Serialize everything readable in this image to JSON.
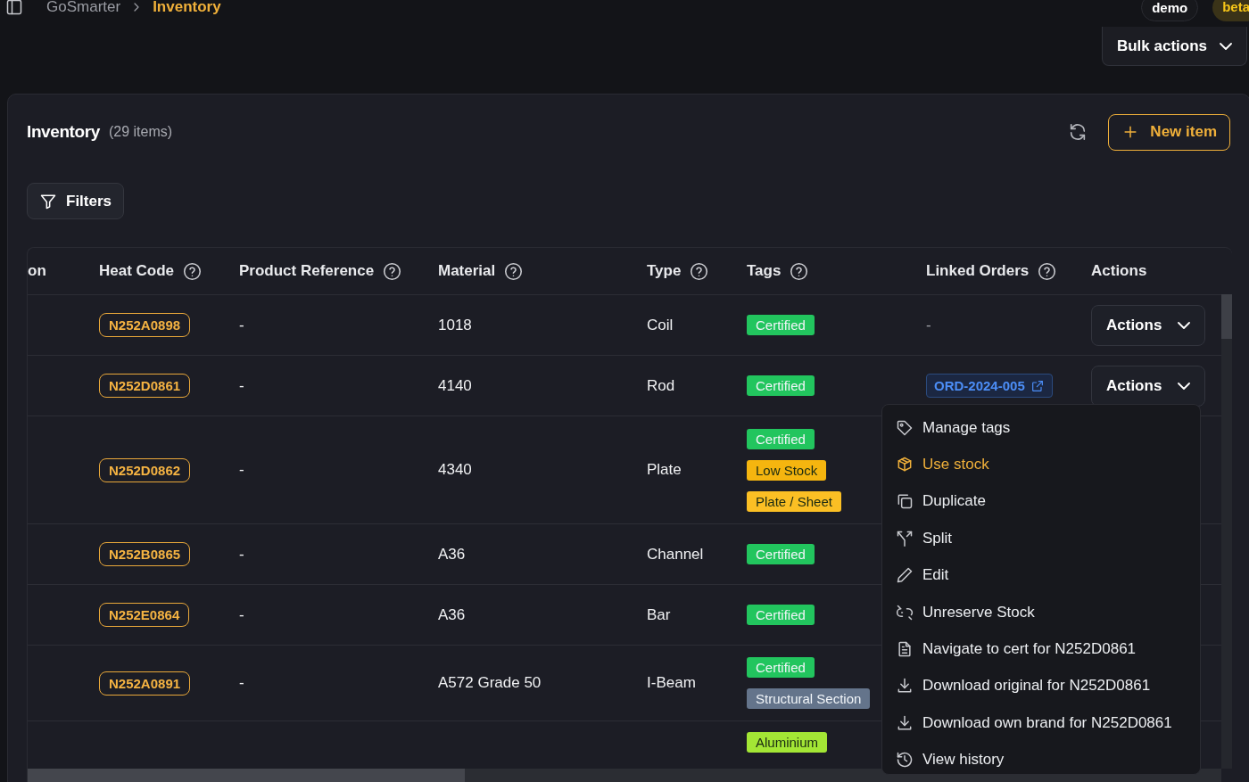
{
  "breadcrumb": [
    {
      "label": "GoSmarter",
      "current": false
    },
    {
      "label": "Inventory",
      "current": true
    }
  ],
  "badges": [
    {
      "label": "demo",
      "kind": "plain"
    },
    {
      "label": "beta",
      "kind": "accent"
    }
  ],
  "bulk_actions": {
    "label": "Bulk actions"
  },
  "card": {
    "title": "Inventory",
    "count": "(29 items)",
    "new_item": "New item",
    "filters": "Filters"
  },
  "table": {
    "columns": [
      {
        "label": "on",
        "help": false
      },
      {
        "label": "Heat Code",
        "help": true
      },
      {
        "label": "Product Reference",
        "help": true
      },
      {
        "label": "Material",
        "help": true
      },
      {
        "label": "Type",
        "help": true
      },
      {
        "label": "Tags",
        "help": true
      },
      {
        "label": "Linked Orders",
        "help": true
      },
      {
        "label": "Actions",
        "help": false
      }
    ],
    "rows": [
      {
        "heat_code": "N252A0898",
        "product_reference": "-",
        "material": "1018",
        "type": "Coil",
        "tags": [
          {
            "label": "Certified",
            "color": "#22c55e"
          }
        ],
        "linked_order": {
          "kind": "text",
          "text": "-"
        },
        "actions": "Actions"
      },
      {
        "heat_code": "N252D0861",
        "product_reference": "-",
        "material": "4140",
        "type": "Rod",
        "tags": [
          {
            "label": "Certified",
            "color": "#22c55e"
          }
        ],
        "linked_order": {
          "kind": "link",
          "text": "ORD-2024-005"
        },
        "actions": "Actions"
      },
      {
        "heat_code": "N252D0862",
        "product_reference": "-",
        "material": "4340",
        "type": "Plate",
        "tags": [
          {
            "label": "Certified",
            "color": "#22c55e"
          },
          {
            "label": "Low Stock",
            "color": "#f5b50f"
          },
          {
            "label": "Plate / Sheet",
            "color": "#fbbf24"
          }
        ]
      },
      {
        "heat_code": "N252B0865",
        "product_reference": "-",
        "material": "A36",
        "type": "Channel",
        "tags": [
          {
            "label": "Certified",
            "color": "#22c55e"
          }
        ]
      },
      {
        "heat_code": "N252E0864",
        "product_reference": "-",
        "material": "A36",
        "type": "Bar",
        "tags": [
          {
            "label": "Certified",
            "color": "#22c55e"
          }
        ]
      },
      {
        "heat_code": "N252A0891",
        "product_reference": "-",
        "material": "A572 Grade 50",
        "type": "I-Beam",
        "tags": [
          {
            "label": "Certified",
            "color": "#22c55e"
          },
          {
            "label": "Structural Section",
            "color": "#64748b"
          }
        ]
      },
      {
        "tags": [
          {
            "label": "Aluminium",
            "color": "#a3e635"
          }
        ]
      }
    ]
  },
  "menu": {
    "items": [
      {
        "label": "Manage tags",
        "highlighted": false
      },
      {
        "label": "Use stock",
        "highlighted": true
      },
      {
        "label": "Duplicate",
        "highlighted": false
      },
      {
        "label": "Split",
        "highlighted": false
      },
      {
        "label": "Edit",
        "highlighted": false
      },
      {
        "label": "Unreserve Stock",
        "highlighted": false
      },
      {
        "label": "Navigate to cert for N252D0861",
        "highlighted": false
      },
      {
        "label": "Download original for N252D0861",
        "highlighted": false
      },
      {
        "label": "Download own brand for N252D0861",
        "highlighted": false
      },
      {
        "label": "View history",
        "highlighted": false
      }
    ]
  }
}
